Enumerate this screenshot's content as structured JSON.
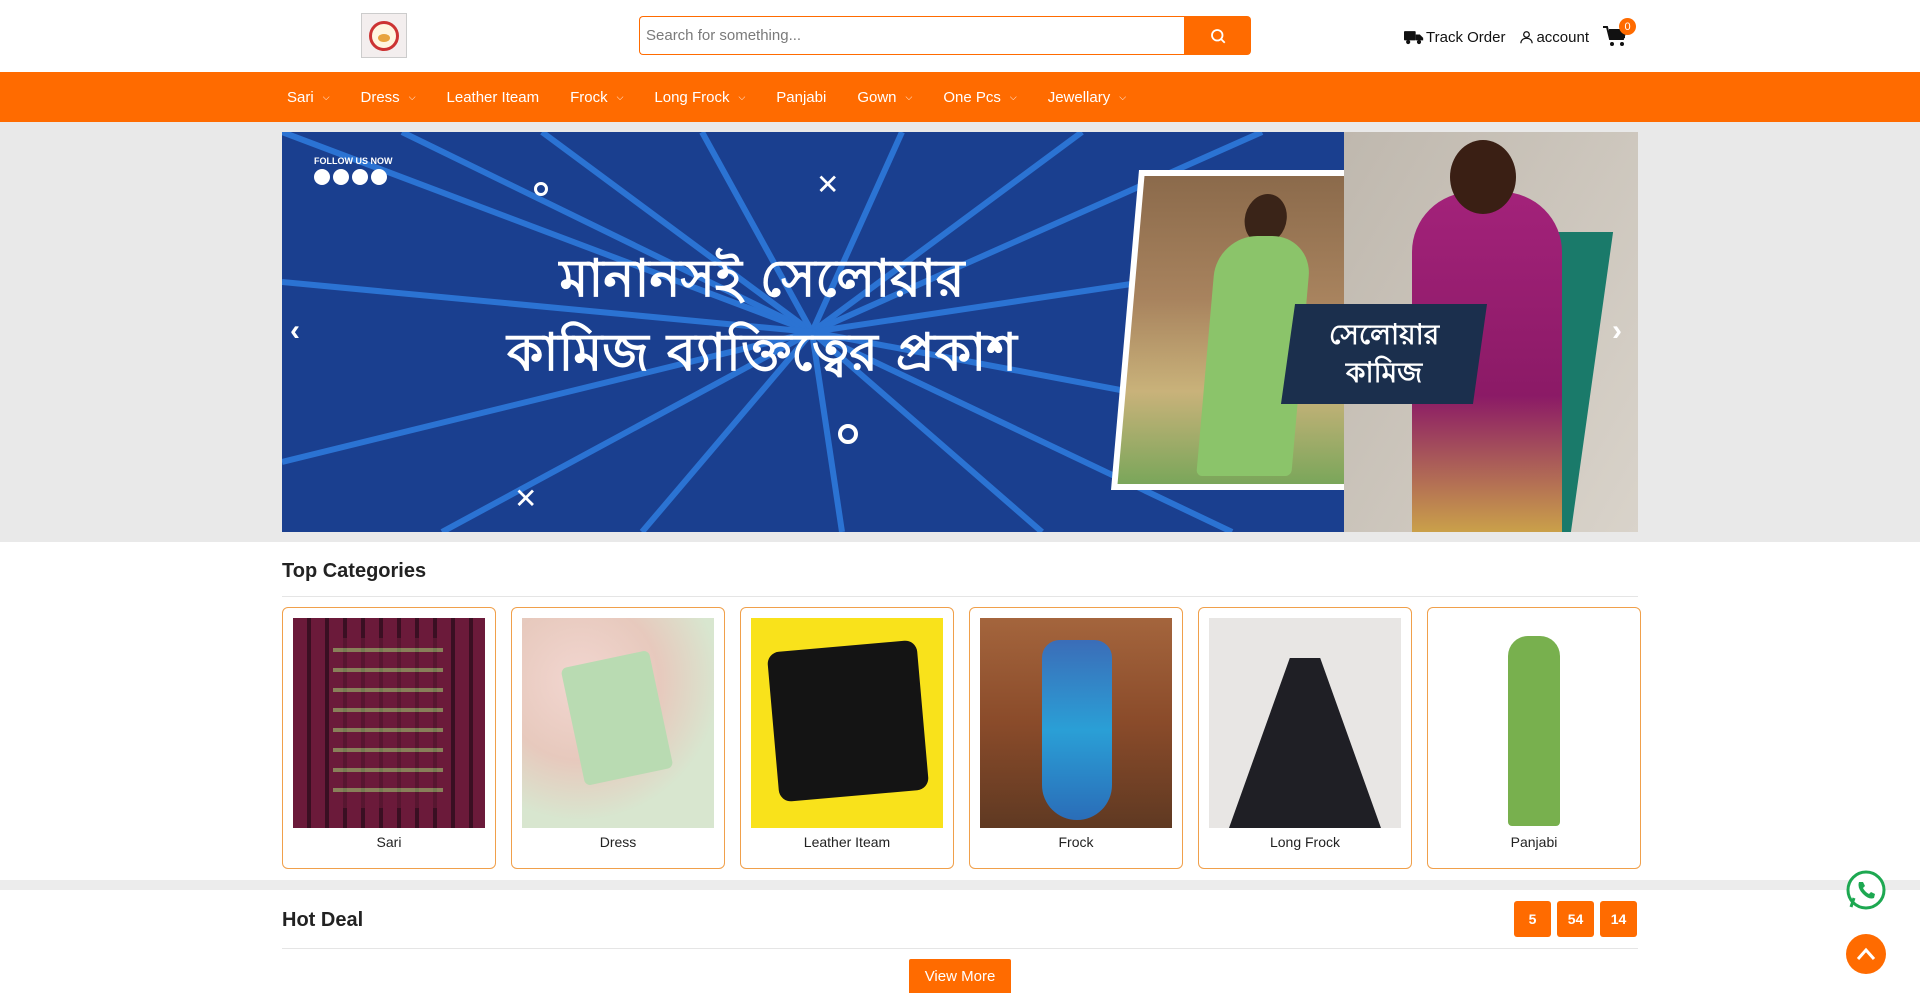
{
  "header": {
    "search_placeholder": "Search for something...",
    "track_order": "Track Order",
    "account": "account",
    "cart_count": "0"
  },
  "nav": {
    "items": [
      {
        "label": "Sari",
        "has_dropdown": true
      },
      {
        "label": "Dress",
        "has_dropdown": true
      },
      {
        "label": "Leather Iteam",
        "has_dropdown": false
      },
      {
        "label": "Frock",
        "has_dropdown": true
      },
      {
        "label": "Long Frock",
        "has_dropdown": true
      },
      {
        "label": "Panjabi",
        "has_dropdown": false
      },
      {
        "label": "Gown",
        "has_dropdown": true
      },
      {
        "label": "One Pcs",
        "has_dropdown": true
      },
      {
        "label": "Jewellary",
        "has_dropdown": true
      }
    ]
  },
  "banner": {
    "follow_text": "FOLLOW US NOW",
    "headline_line1": "মানানসই সেলোয়ার",
    "headline_line2": "কামিজ ব্যাক্তিত্বের প্রকাশ",
    "tag_line1": "সেলোয়ার",
    "tag_line2": "কামিজ"
  },
  "top_categories": {
    "title": "Top Categories",
    "items": [
      {
        "label": "Sari"
      },
      {
        "label": "Dress"
      },
      {
        "label": "Leather Iteam"
      },
      {
        "label": "Frock"
      },
      {
        "label": "Long Frock"
      },
      {
        "label": "Panjabi"
      }
    ]
  },
  "hot_deal": {
    "title": "Hot Deal",
    "timer": [
      "5",
      "54",
      "14"
    ],
    "view_more": "View More"
  },
  "colors": {
    "accent": "#ff6b00",
    "banner_blue": "#1a3f8f"
  }
}
